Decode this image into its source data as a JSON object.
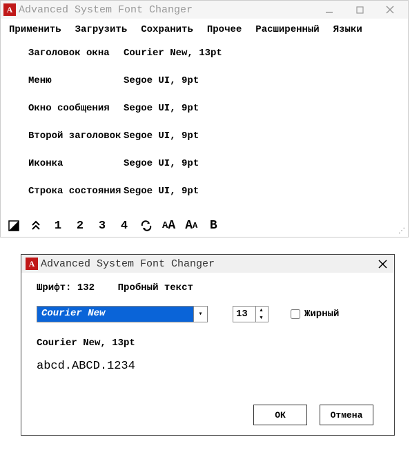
{
  "main_window": {
    "title": "Advanced System Font Changer",
    "menu": [
      "Применить",
      "Загрузить",
      "Сохранить",
      "Прочее",
      "Расширенный",
      "Языки"
    ],
    "rows": [
      {
        "label": "Заголовок окна",
        "value": "Courier New, 13pt"
      },
      {
        "label": "Меню",
        "value": "Segoe UI, 9pt"
      },
      {
        "label": "Окно сообщения",
        "value": "Segoe UI, 9pt"
      },
      {
        "label": "Второй заголовок",
        "value": "Segoe UI, 9pt"
      },
      {
        "label": "Иконка",
        "value": "Segoe UI, 9pt"
      },
      {
        "label": "Строка состояния",
        "value": "Segoe UI, 9pt"
      }
    ],
    "toolbar_numbers": [
      "1",
      "2",
      "3",
      "4"
    ]
  },
  "dialog": {
    "title": "Advanced System Font Changer",
    "header_font_label": "Шрифт:",
    "header_count": "132",
    "header_sample_label": "Пробный текст",
    "font_selected": "Courier New",
    "size_value": "13",
    "bold_label": "Жирный",
    "preview_line": "Courier New, 13pt",
    "sample_text": "abcd.ABCD.1234",
    "ok_label": "ОК",
    "cancel_label": "Отмена"
  }
}
